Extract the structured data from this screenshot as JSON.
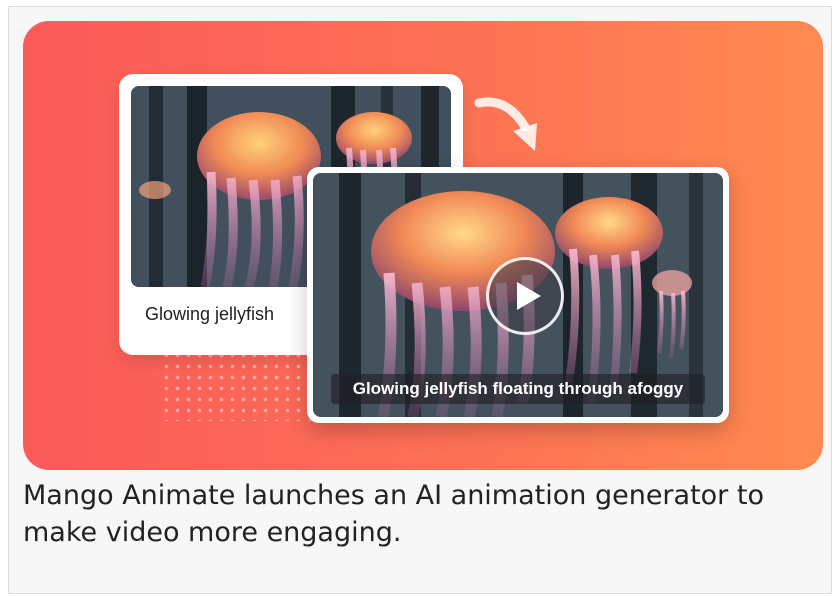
{
  "hero": {
    "back_card_caption": "Glowing jellyfish",
    "video_subtitle": "Glowing jellyfish floating through afoggy",
    "play_icon": "play-icon",
    "arrow_icon": "curved-arrow-icon"
  },
  "caption": {
    "text": "Mango Animate launches an AI animation generator to make video more engaging."
  },
  "colors": {
    "gradient_start": "#fb5a5a",
    "gradient_end": "#fe8a50"
  }
}
